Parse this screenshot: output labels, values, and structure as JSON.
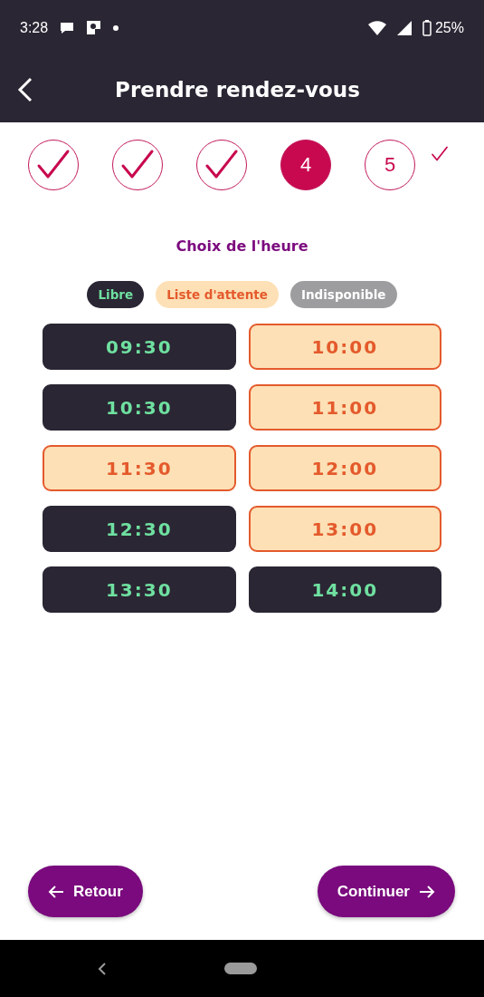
{
  "status_bar": {
    "time": "3:28",
    "battery": "25%"
  },
  "app_bar": {
    "title": "Prendre rendez-vous"
  },
  "steps": [
    {
      "kind": "done"
    },
    {
      "kind": "done"
    },
    {
      "kind": "done"
    },
    {
      "kind": "current",
      "label": "4"
    },
    {
      "kind": "upcoming",
      "label": "5"
    }
  ],
  "section_title": "Choix de l'heure",
  "legend": [
    {
      "kind": "free",
      "label": "Libre"
    },
    {
      "kind": "waitlist",
      "label": "Liste d'attente"
    },
    {
      "kind": "unavailable",
      "label": "Indisponible"
    }
  ],
  "slots": [
    {
      "time": "09:30",
      "kind": "free"
    },
    {
      "time": "10:00",
      "kind": "waitlist"
    },
    {
      "time": "10:30",
      "kind": "free"
    },
    {
      "time": "11:00",
      "kind": "waitlist"
    },
    {
      "time": "11:30",
      "kind": "waitlist"
    },
    {
      "time": "12:00",
      "kind": "waitlist"
    },
    {
      "time": "12:30",
      "kind": "free"
    },
    {
      "time": "13:00",
      "kind": "waitlist"
    },
    {
      "time": "13:30",
      "kind": "free"
    },
    {
      "time": "14:00",
      "kind": "free"
    }
  ],
  "buttons": {
    "back": "Retour",
    "next": "Continuer"
  }
}
